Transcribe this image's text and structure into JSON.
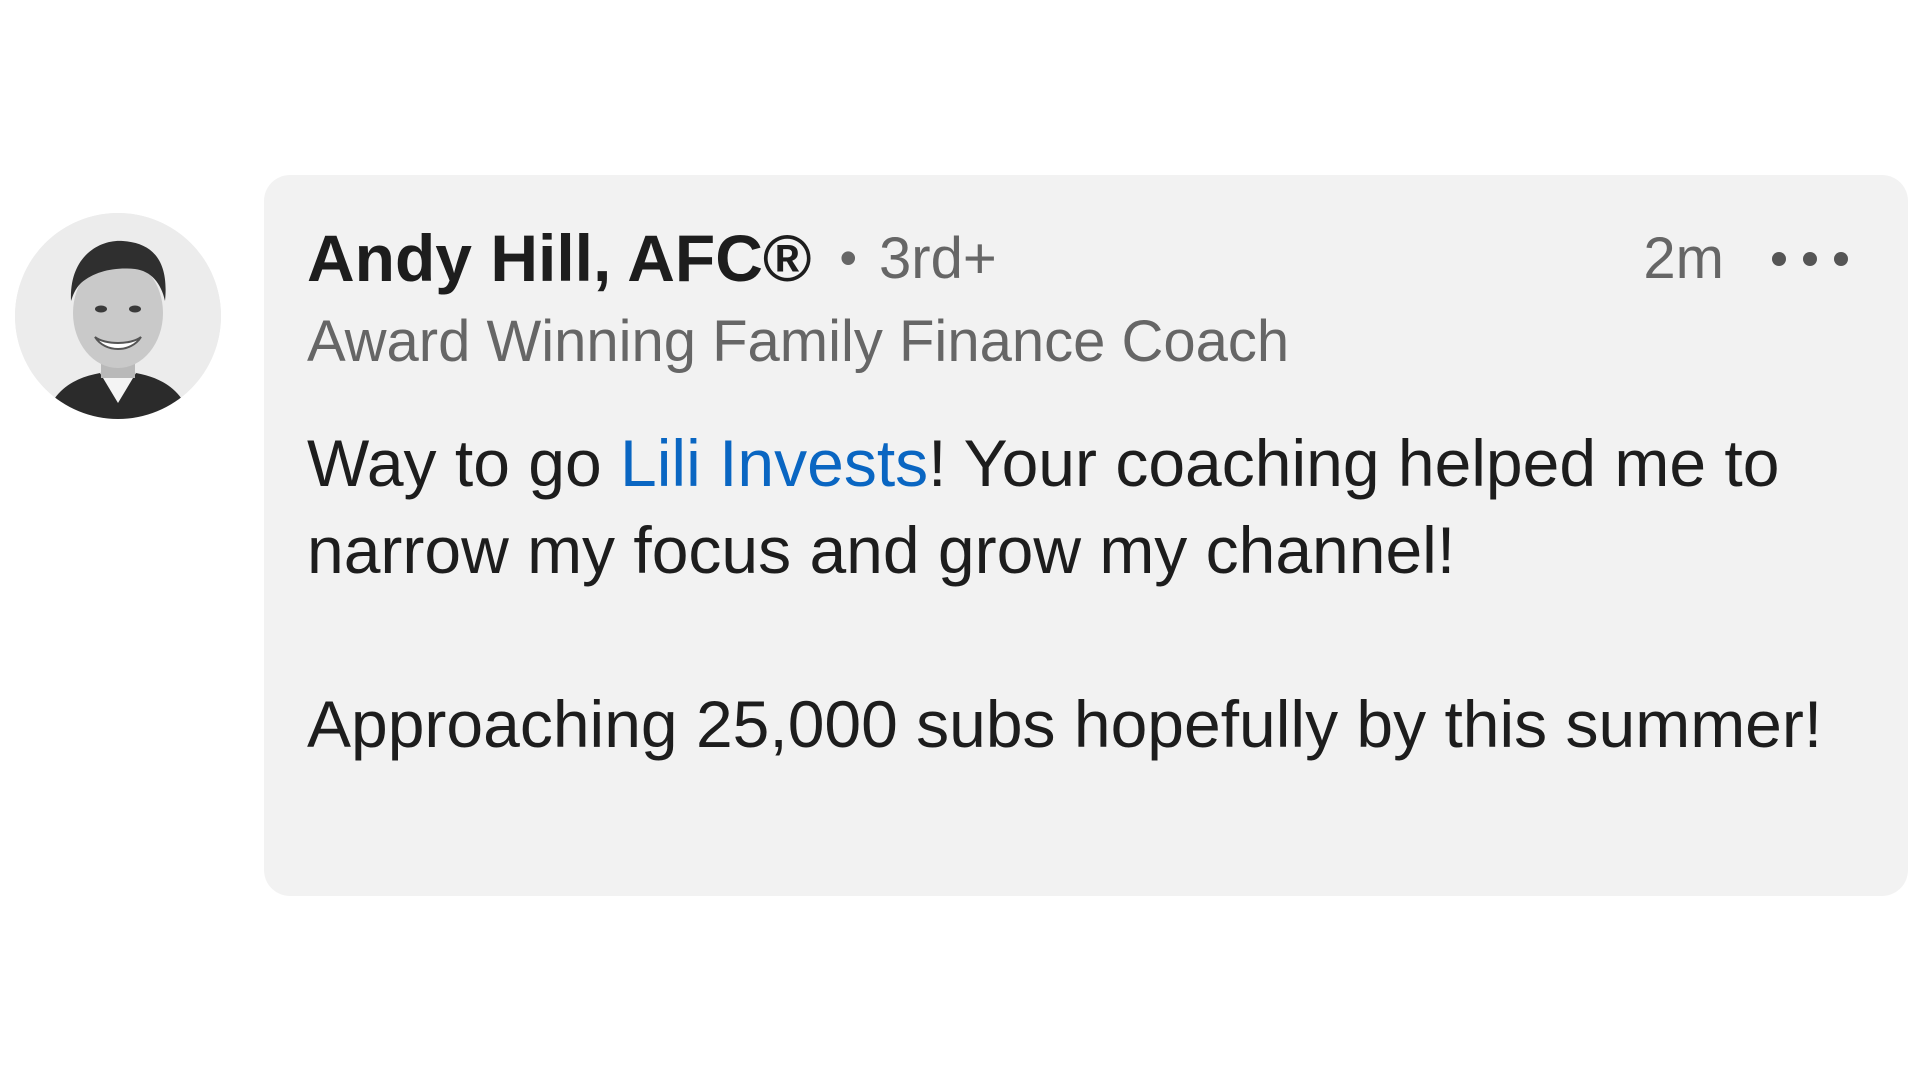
{
  "comment": {
    "author": {
      "name": "Andy Hill, AFC®",
      "separator": "•",
      "connection_degree": "3rd+",
      "headline": "Award Winning Family Finance Coach"
    },
    "timestamp": "2m",
    "more_icon": "more-horizontal-icon",
    "body": {
      "line1_prefix": "Way to go ",
      "mention": "Lili Invests",
      "line1_suffix": "! Your coaching helped me to narrow my focus and grow my channel!",
      "paragraph2": "Approaching 25,000 subs hopefully by this summer!"
    }
  },
  "colors": {
    "bubble_background": "#f2f2f2",
    "mention_link": "#0a66c2",
    "primary_text": "#1d1d1d",
    "secondary_text": "#666666"
  }
}
